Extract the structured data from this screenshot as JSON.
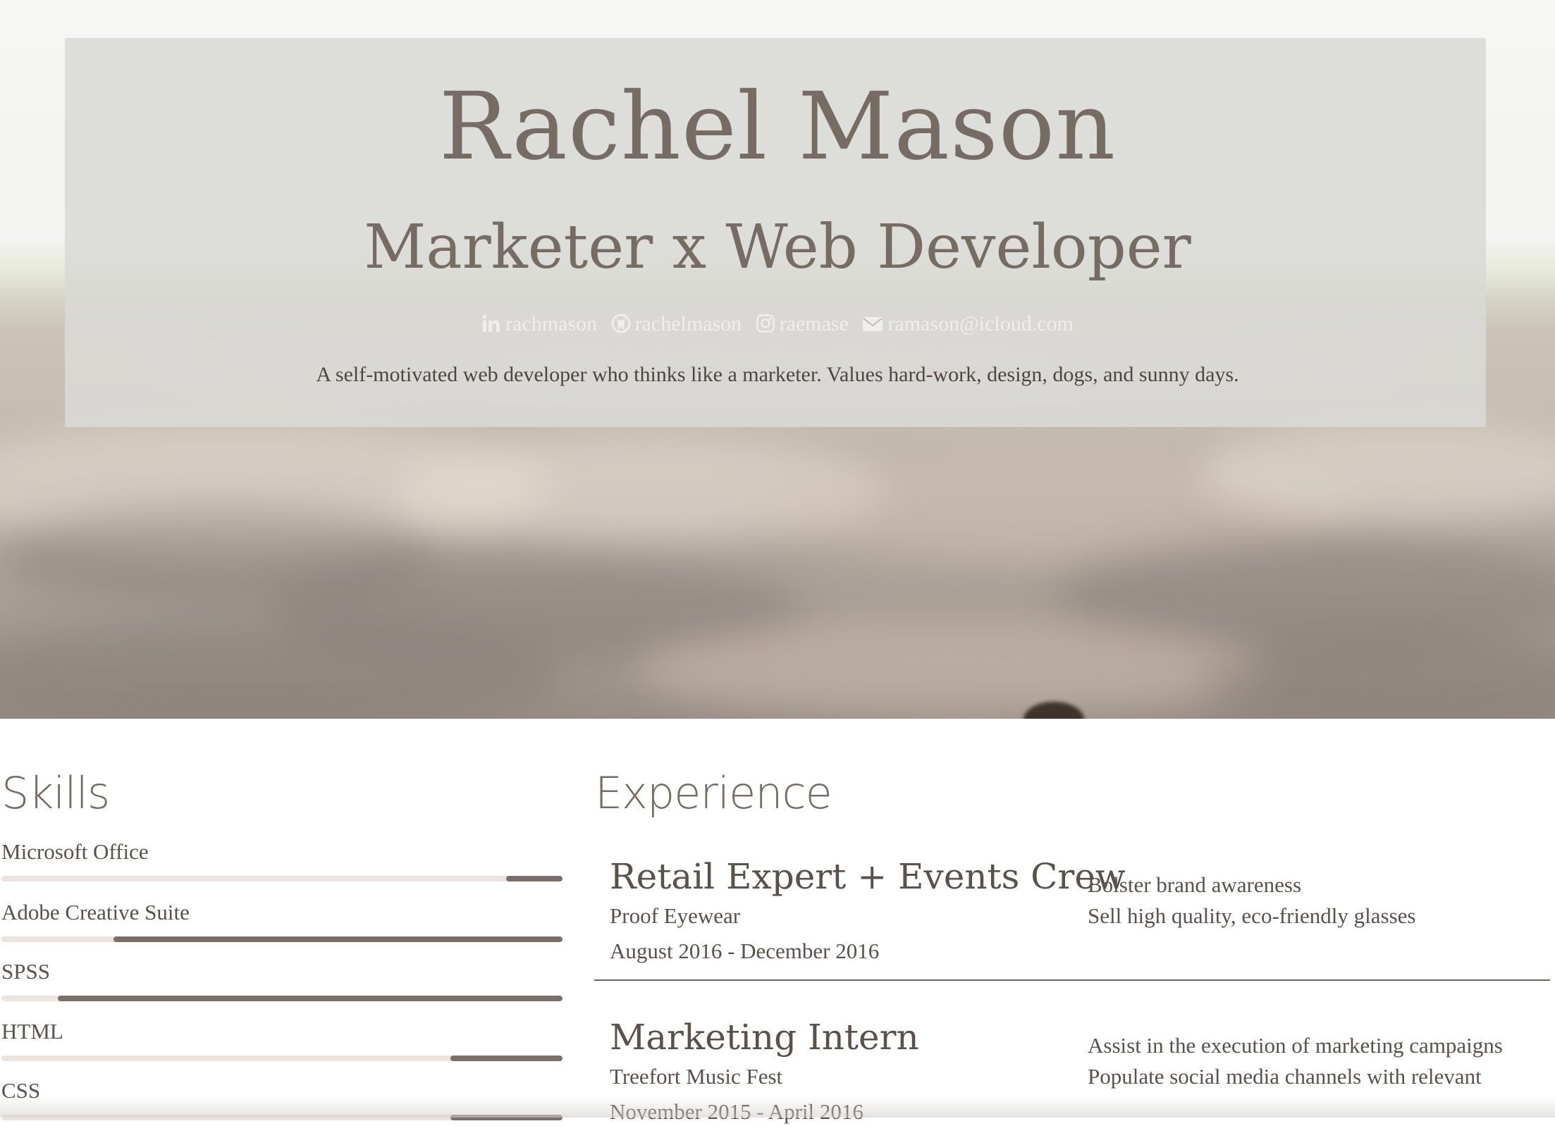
{
  "hero": {
    "name": "Rachel Mason",
    "title": "Marketer x Web Developer",
    "links": [
      {
        "icon": "linkedin-icon",
        "label": "rachmason"
      },
      {
        "icon": "github-icon",
        "label": "rachelmason"
      },
      {
        "icon": "instagram-icon",
        "label": "raemase"
      },
      {
        "icon": "envelope-icon",
        "label": "ramason@icloud.com"
      }
    ],
    "bio": "A self-motivated web developer who thinks like a marketer. Values hard-work, design, dogs, and sunny days."
  },
  "skills": {
    "heading": "Skills",
    "items": [
      {
        "label": "Microsoft Office",
        "level": 0.1
      },
      {
        "label": "Adobe Creative Suite",
        "level": 0.8
      },
      {
        "label": "SPSS",
        "level": 0.9
      },
      {
        "label": "HTML",
        "level": 0.2
      },
      {
        "label": "CSS",
        "level": 0.2
      }
    ]
  },
  "experience": {
    "heading": "Experience",
    "jobs": [
      {
        "title": "Retail Expert + Events Crew",
        "company": "Proof Eyewear",
        "dates": "August 2016 - December 2016",
        "duties": [
          "Bolster brand awareness",
          "Sell high quality, eco-friendly glasses"
        ]
      },
      {
        "title": "Marketing Intern",
        "company": "Treefort Music Fest",
        "dates": "November 2015 - April 2016",
        "duties": [
          "Assist in the execution of marketing campaigns",
          "Populate social media channels with relevant"
        ]
      }
    ]
  },
  "colors": {
    "accent": "#7a7068",
    "track": "#ece4dc",
    "text": "#5a514b",
    "panel": "#dad9d6"
  }
}
